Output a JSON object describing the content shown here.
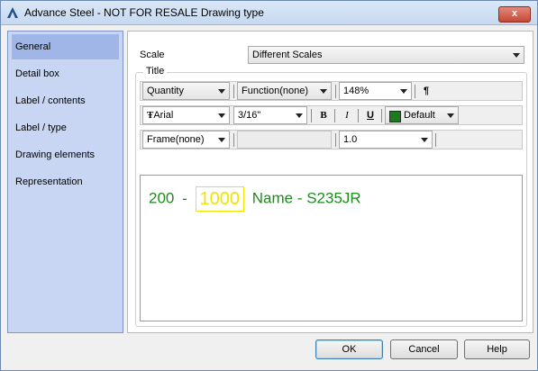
{
  "window": {
    "title": "Advance Steel - NOT FOR RESALE  Drawing type",
    "close_label": "x"
  },
  "sidebar": {
    "items": [
      {
        "label": "General",
        "selected": true
      },
      {
        "label": "Detail box"
      },
      {
        "label": "Label / contents"
      },
      {
        "label": "Label / type"
      },
      {
        "label": "Drawing elements"
      },
      {
        "label": "Representation"
      }
    ]
  },
  "main": {
    "scale_label": "Scale",
    "scale_value": "Different Scales",
    "title_group_label": "Title",
    "toolbar1": {
      "quantity": "Quantity",
      "function": "Function(none)",
      "zoom": "148%",
      "paragraph_glyph": "¶"
    },
    "toolbar2": {
      "font_glyph": "Ŧ",
      "font": "Arial",
      "size": "3/16\"",
      "bold": "B",
      "italic": "I",
      "underline": "U",
      "color_name": "Default",
      "color_hex": "#1e7a1e"
    },
    "toolbar3": {
      "frame": "Frame(none)",
      "spacing": "1.0"
    },
    "editor": {
      "part1": "200",
      "dash1": "-",
      "boxed": "1000",
      "part2": "Name - S235JR",
      "text_color": "#1e8a1e",
      "box_color": "#f0e400"
    }
  },
  "footer": {
    "ok": "OK",
    "cancel": "Cancel",
    "help": "Help"
  }
}
